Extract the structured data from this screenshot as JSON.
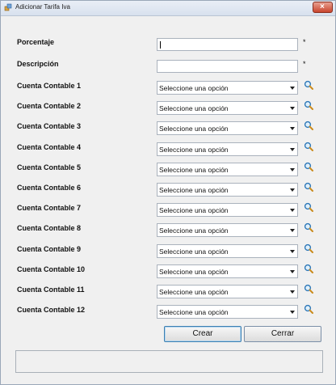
{
  "window": {
    "title": "Adicionar Tarifa Iva",
    "close_glyph": "×"
  },
  "form": {
    "porcentaje": {
      "label": "Porcentaje",
      "value": "",
      "required": "*"
    },
    "descripcion": {
      "label": "Descripción",
      "value": "",
      "required": "*"
    },
    "cuentas": [
      {
        "label": "Cuenta Contable 1",
        "value": "Seleccione una opción"
      },
      {
        "label": "Cuenta Contable 2",
        "value": "Seleccione una opción"
      },
      {
        "label": "Cuenta Contable 3",
        "value": "Seleccione una opción"
      },
      {
        "label": "Cuenta Contable 4",
        "value": "Seleccione una opción"
      },
      {
        "label": "Cuenta Contable 5",
        "value": "Seleccione una opción"
      },
      {
        "label": "Cuenta Contable 6",
        "value": "Seleccione una opción"
      },
      {
        "label": "Cuenta Contable 7",
        "value": "Seleccione una opción"
      },
      {
        "label": "Cuenta Contable 8",
        "value": "Seleccione una opción"
      },
      {
        "label": "Cuenta Contable 9",
        "value": "Seleccione una opción"
      },
      {
        "label": "Cuenta Contable 10",
        "value": "Seleccione una opción"
      },
      {
        "label": "Cuenta Contable 11",
        "value": "Seleccione una opción"
      },
      {
        "label": "Cuenta Contable 12",
        "value": "Seleccione una opción"
      }
    ]
  },
  "buttons": {
    "crear": "Crear",
    "cerrar": "Cerrar"
  },
  "status": {
    "text": ""
  }
}
